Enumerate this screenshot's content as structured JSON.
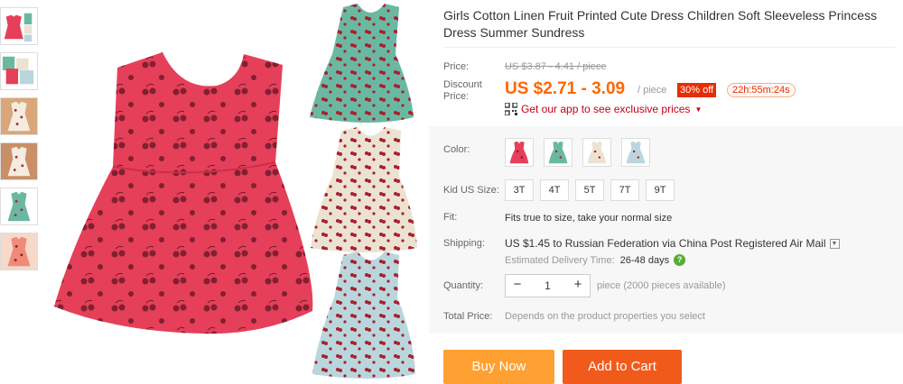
{
  "product": {
    "title": "Girls Cotton Linen Fruit Printed Cute Dress Children Soft Sleeveless Princess Dress Summer Sundress"
  },
  "price": {
    "label": "Price:",
    "original": "US $3.87 - 4.41 / piece",
    "discount_label": "Discount Price:",
    "discount": "US $2.71 - 3.09",
    "unit": "/ piece",
    "percent_off": "30% off",
    "countdown": "22h:55m:24s"
  },
  "app_promo": {
    "text": "Get our app to see exclusive prices"
  },
  "color": {
    "label": "Color:",
    "options": [
      "red",
      "green",
      "beige",
      "blue"
    ]
  },
  "size": {
    "label": "Kid US Size:",
    "options": [
      "3T",
      "4T",
      "5T",
      "7T",
      "9T"
    ]
  },
  "fit": {
    "label": "Fit:",
    "text": "Fits true to size, take your normal size"
  },
  "shipping": {
    "label": "Shipping:",
    "text": "US $1.45 to Russian Federation via China Post Registered Air Mail",
    "delivery_label": "Estimated Delivery Time:",
    "delivery_days": "26-48 days"
  },
  "quantity": {
    "label": "Quantity:",
    "value": "1",
    "minus": "−",
    "plus": "+",
    "available": "piece (2000 pieces available)"
  },
  "total": {
    "label": "Total Price:",
    "text": "Depends on the product properties you select"
  },
  "buttons": {
    "buy_now": "Buy Now",
    "add_to_cart": "Add to Cart"
  },
  "colors": {
    "accent_orange": "#f60",
    "badge_red": "#e62e04",
    "buy_now_bg": "#ffa033",
    "add_to_cart_bg": "#f05b1c",
    "dress_red": "#e63f5a",
    "dress_green": "#6bb8a2",
    "dress_beige": "#ece2d2",
    "dress_blue": "#b9d6dd"
  }
}
